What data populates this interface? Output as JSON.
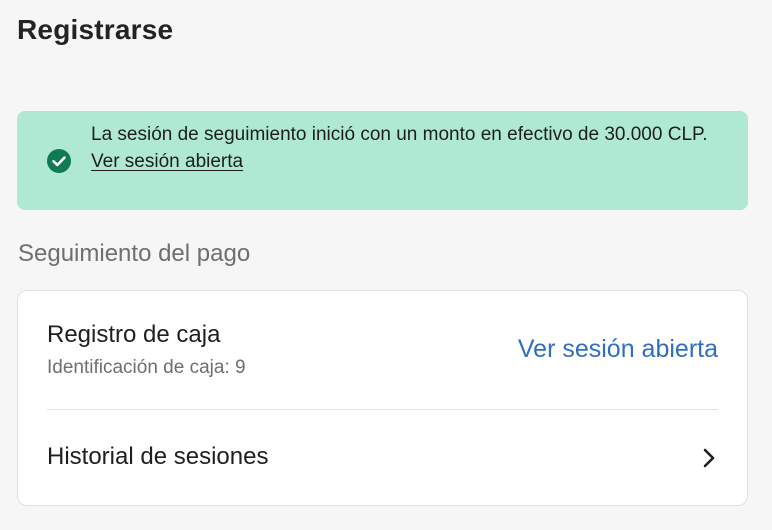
{
  "page": {
    "title": "Registrarse"
  },
  "banner": {
    "message": "La sesión de seguimiento inició con un monto en efectivo de 30.000 CLP.",
    "link": "Ver sesión abierta",
    "icon": "check-circle-icon",
    "color": "#afe9d1"
  },
  "section": {
    "heading": "Seguimiento del pago"
  },
  "card": {
    "register": {
      "title": "Registro de caja",
      "id_label": "Identificación de caja: 9",
      "link": "Ver sesión abierta"
    },
    "history": {
      "label": "Historial de sesiones",
      "icon": "chevron-right-icon"
    }
  },
  "colors": {
    "accent_link": "#2f6fc2",
    "success_icon": "#0f7a53",
    "background": "#f6f6f7"
  }
}
